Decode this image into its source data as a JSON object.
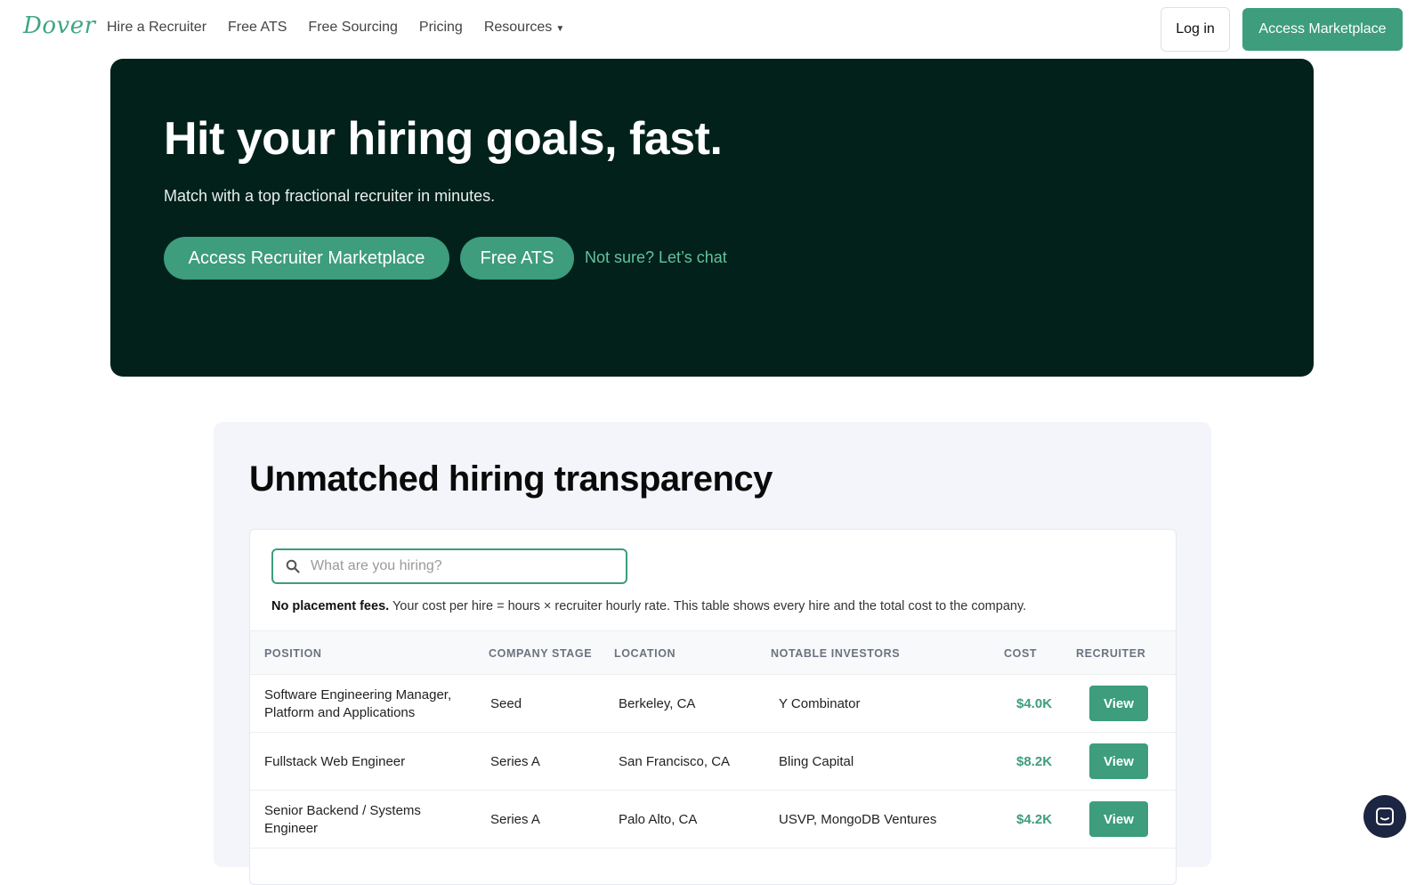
{
  "nav": {
    "logo": "Dover",
    "links": [
      "Hire a Recruiter",
      "Free ATS",
      "Free Sourcing",
      "Pricing",
      "Resources"
    ],
    "login": "Log in",
    "cta": "Access Marketplace"
  },
  "hero": {
    "title": "Hit your hiring goals, fast.",
    "subtitle": "Match with a top fractional recruiter in minutes.",
    "primary_button": "Access Recruiter Marketplace",
    "secondary_button": "Free ATS",
    "chat_link": "Not sure? Let’s chat"
  },
  "section": {
    "title": "Unmatched hiring transparency",
    "search_placeholder": "What are you hiring?",
    "note_bold": "No placement fees.",
    "note_rest": " Your cost per hire = hours × recruiter hourly rate. This table shows every hire and the total cost to the company.",
    "columns": [
      "POSITION",
      "COMPANY STAGE",
      "LOCATION",
      "NOTABLE INVESTORS",
      "COST",
      "RECRUITER"
    ],
    "rows": [
      {
        "position": "Software Engineering Manager, Platform and Applications",
        "stage": "Seed",
        "location": "Berkeley, CA",
        "investors": "Y Combinator",
        "cost": "$4.0K",
        "action": "View"
      },
      {
        "position": "Fullstack Web Engineer",
        "stage": "Series A",
        "location": "San Francisco, CA",
        "investors": "Bling Capital",
        "cost": "$8.2K",
        "action": "View"
      },
      {
        "position": "Senior Backend / Systems Engineer",
        "stage": "Series A",
        "location": "Palo Alto, CA",
        "investors": "USVP, MongoDB Ventures",
        "cost": "$4.2K",
        "action": "View"
      }
    ]
  },
  "colors": {
    "accent": "#3d9d7c",
    "hero_bg": "#02211a",
    "section_bg": "#f4f5fb",
    "chat_bubble": "#1c2541"
  }
}
